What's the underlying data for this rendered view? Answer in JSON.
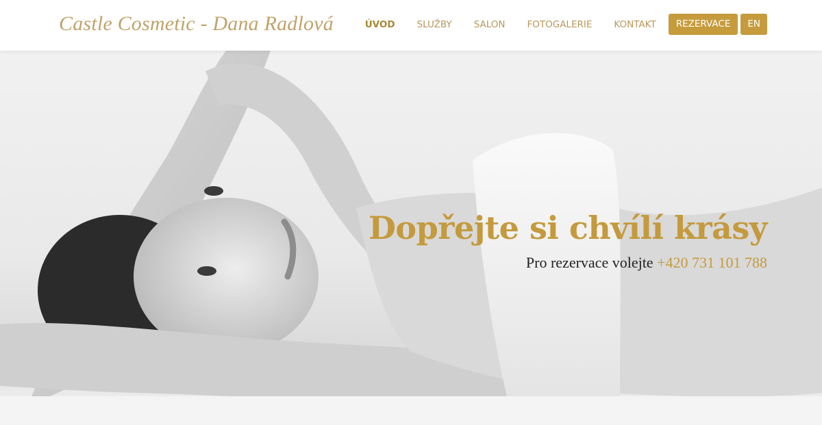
{
  "header": {
    "logo": "Castle Cosmetic - Dana Radlová",
    "nav": [
      {
        "label": "ÚVOD"
      },
      {
        "label": "SLUŽBY"
      },
      {
        "label": "SALON"
      },
      {
        "label": "FOTOGALERIE"
      },
      {
        "label": "KONTAKT"
      }
    ],
    "reserve_label": "REZERVACE",
    "lang_label": "EN"
  },
  "hero": {
    "title": "Dopřejte si chvílí krásy",
    "subtitle_prefix": "Pro rezervace volejte",
    "phone": "+420 731 101 788"
  },
  "colors": {
    "accent": "#c59b3c",
    "nav_text": "#b8985a",
    "logo_text": "#bfa36a",
    "subtitle_text": "#222222"
  },
  "icons": []
}
